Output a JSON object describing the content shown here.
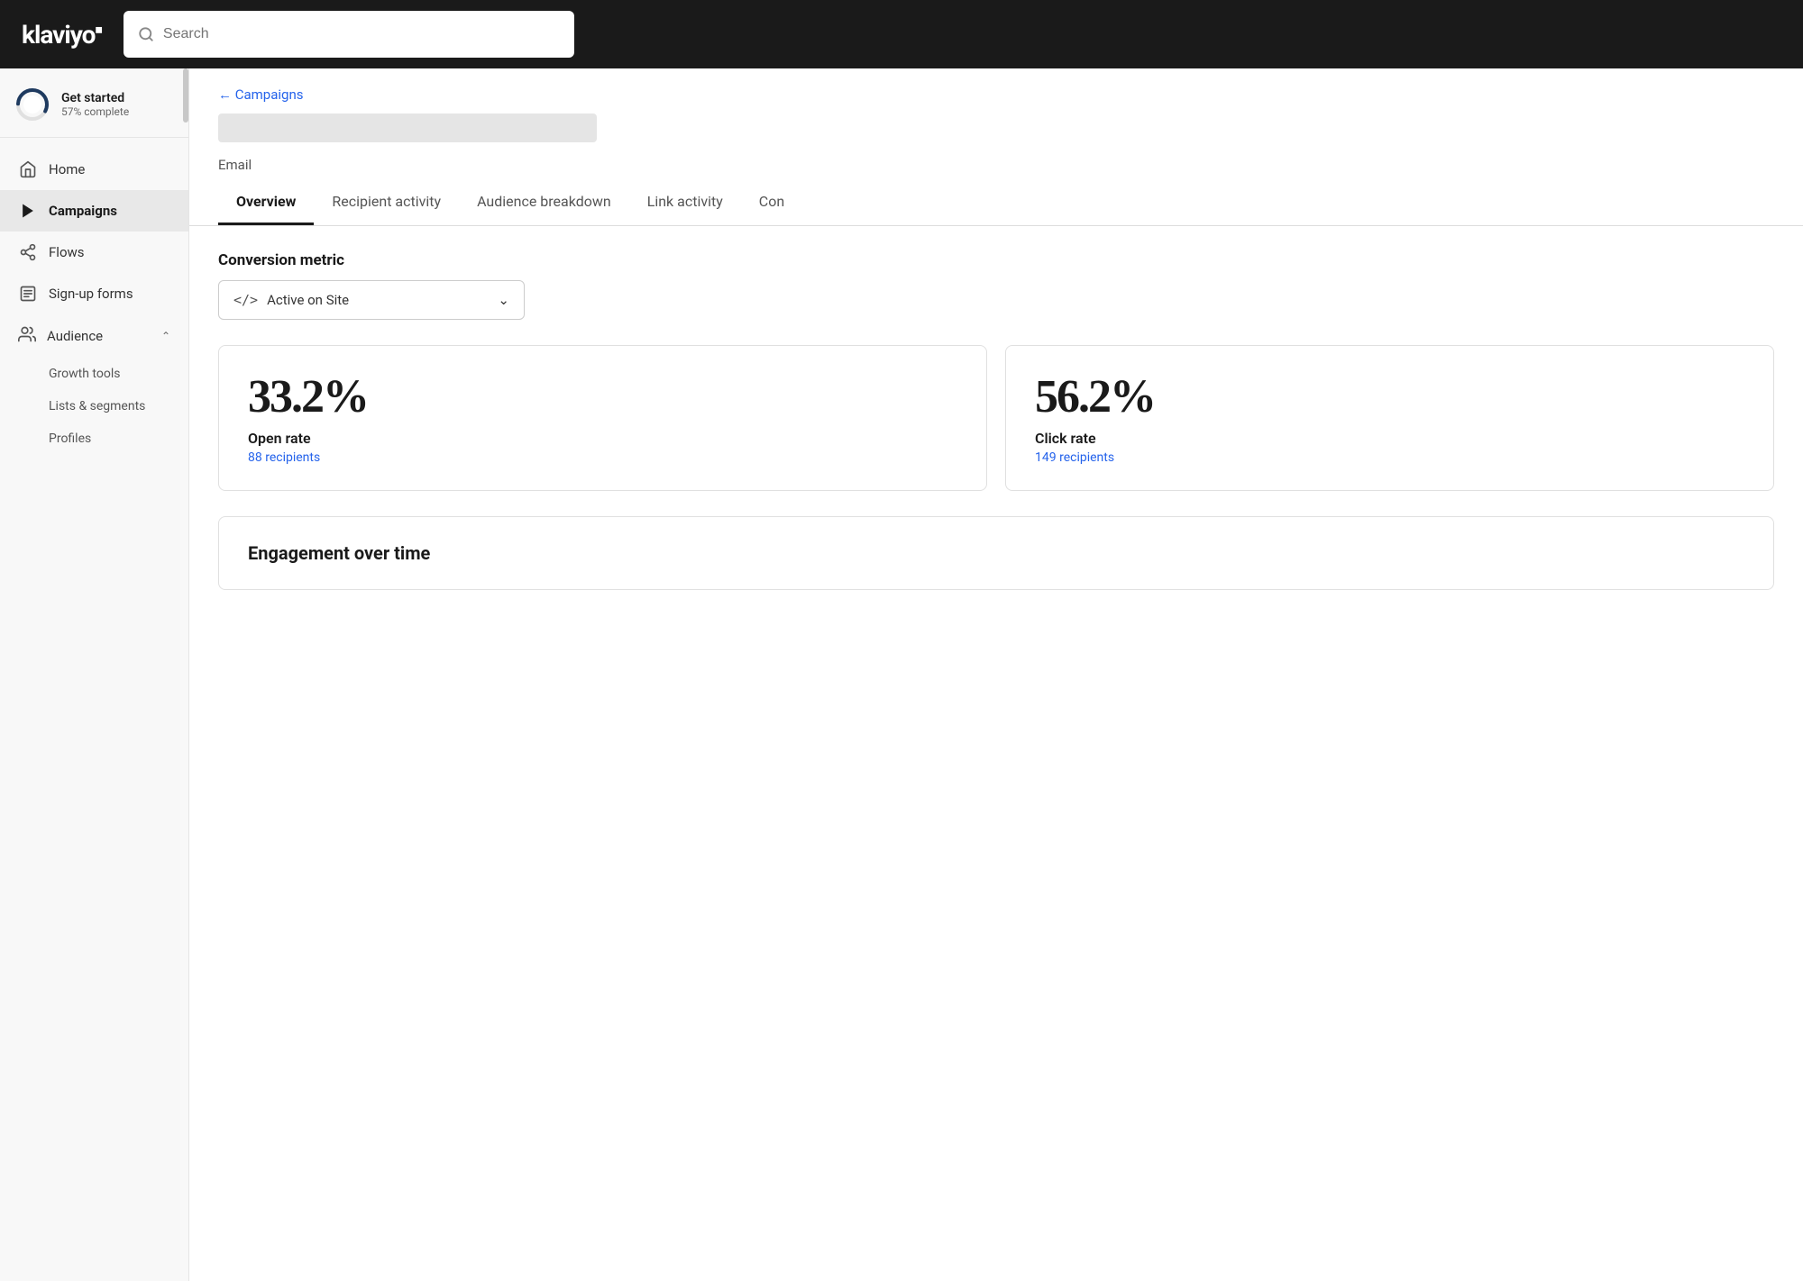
{
  "app": {
    "logo": "klaviyo",
    "logo_mark": "■"
  },
  "search": {
    "placeholder": "Search"
  },
  "sidebar": {
    "get_started": {
      "title": "Get started",
      "subtitle": "57% complete",
      "progress": 57
    },
    "nav_items": [
      {
        "id": "home",
        "label": "Home",
        "icon": "home"
      },
      {
        "id": "campaigns",
        "label": "Campaigns",
        "icon": "campaigns",
        "active": true
      },
      {
        "id": "flows",
        "label": "Flows",
        "icon": "flows"
      },
      {
        "id": "signup_forms",
        "label": "Sign-up forms",
        "icon": "signup_forms"
      }
    ],
    "audience": {
      "label": "Audience",
      "expanded": true,
      "sub_items": [
        {
          "id": "growth_tools",
          "label": "Growth tools"
        },
        {
          "id": "lists_segments",
          "label": "Lists & segments"
        },
        {
          "id": "profiles",
          "label": "Profiles"
        }
      ]
    }
  },
  "breadcrumb": {
    "back_label": "← Campaigns"
  },
  "campaign": {
    "type_label": "Email"
  },
  "tabs": [
    {
      "id": "overview",
      "label": "Overview",
      "active": true
    },
    {
      "id": "recipient_activity",
      "label": "Recipient activity"
    },
    {
      "id": "audience_breakdown",
      "label": "Audience breakdown"
    },
    {
      "id": "link_activity",
      "label": "Link activity"
    },
    {
      "id": "content",
      "label": "Con"
    }
  ],
  "conversion_metric": {
    "label": "Conversion metric",
    "selected": "Active on Site",
    "icon": "</>"
  },
  "metrics": [
    {
      "id": "open_rate",
      "value": "33.2%",
      "label": "Open rate",
      "recipients_text": "88 recipients"
    },
    {
      "id": "click_rate",
      "value": "56.2%",
      "label": "Click rate",
      "recipients_text": "149 recipients"
    }
  ],
  "engagement": {
    "title": "Engagement over time"
  }
}
